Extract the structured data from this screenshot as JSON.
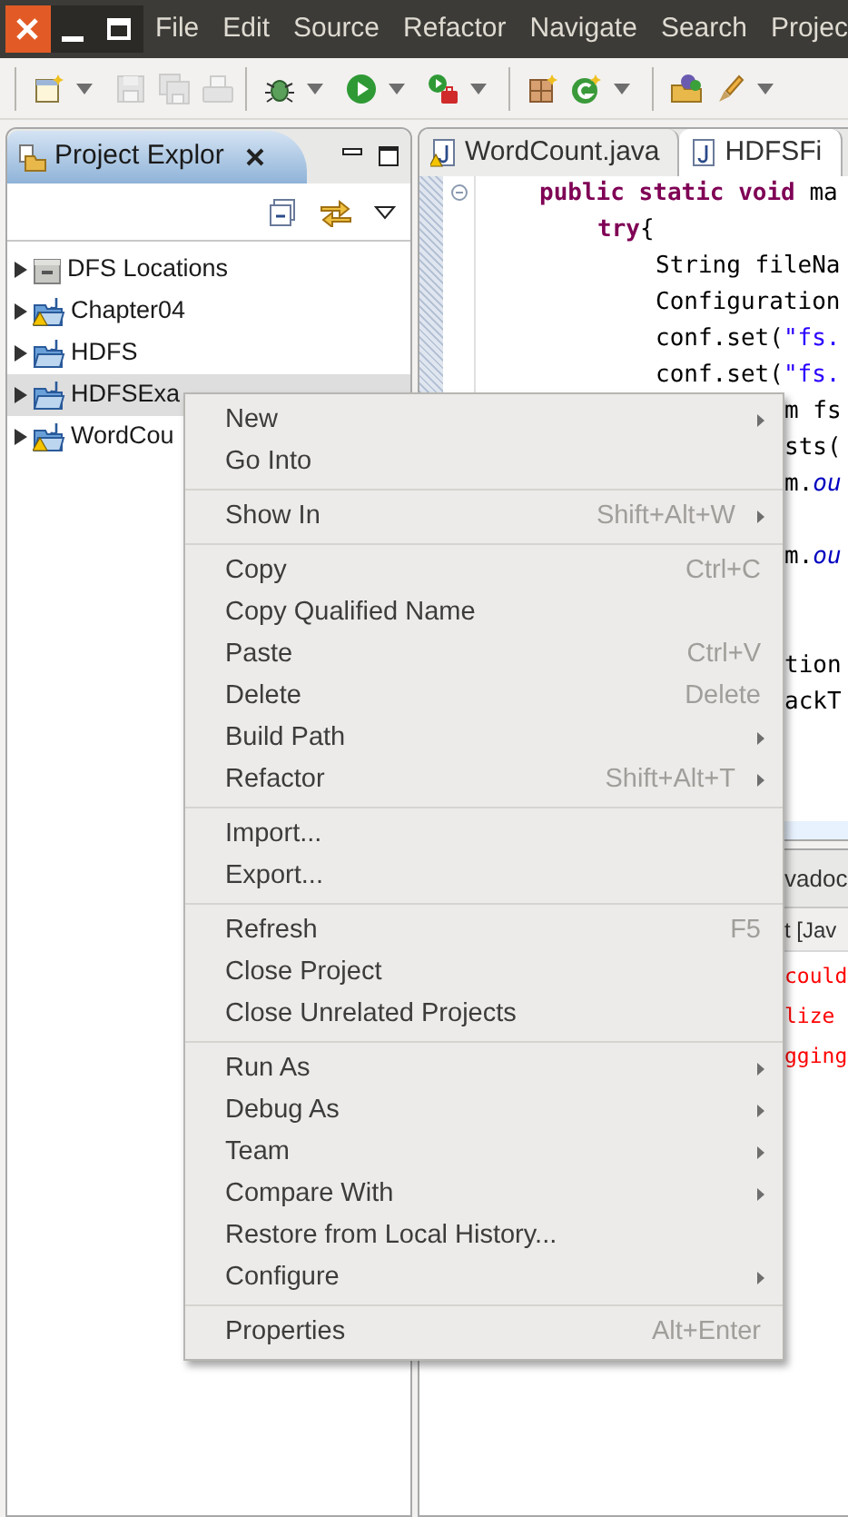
{
  "menubar": {
    "items": [
      "File",
      "Edit",
      "Source",
      "Refactor",
      "Navigate",
      "Search",
      "Projec"
    ]
  },
  "toolbar": {
    "groups": [
      [
        {
          "kind": "new",
          "disabled": false,
          "dropdown": true
        },
        {
          "kind": "save",
          "disabled": true,
          "dropdown": false
        },
        {
          "kind": "saveall",
          "disabled": true,
          "dropdown": false
        },
        {
          "kind": "print",
          "disabled": true,
          "dropdown": false
        }
      ],
      [
        {
          "kind": "debug",
          "disabled": false,
          "dropdown": true
        },
        {
          "kind": "run",
          "disabled": false,
          "dropdown": true
        },
        {
          "kind": "external",
          "disabled": false,
          "dropdown": true
        }
      ],
      [
        {
          "kind": "package",
          "disabled": false,
          "dropdown": false
        },
        {
          "kind": "newclass",
          "disabled": false,
          "dropdown": true
        }
      ],
      [
        {
          "kind": "openfolder",
          "disabled": false,
          "dropdown": false
        },
        {
          "kind": "brush",
          "disabled": false,
          "dropdown": true
        }
      ]
    ]
  },
  "explorer": {
    "title": "Project Explor",
    "items": [
      {
        "label": "DFS Locations",
        "kind": "dfs",
        "warning": false,
        "selected": false
      },
      {
        "label": "Chapter04",
        "kind": "project",
        "warning": true,
        "selected": false
      },
      {
        "label": "HDFS",
        "kind": "project",
        "warning": false,
        "selected": false
      },
      {
        "label": "HDFSExa",
        "kind": "project",
        "warning": false,
        "selected": true
      },
      {
        "label": "WordCou",
        "kind": "project",
        "warning": true,
        "selected": false
      }
    ]
  },
  "editor": {
    "tabs": [
      {
        "label": "WordCount.java",
        "warning": true,
        "selected": false
      },
      {
        "label": "HDFSFi",
        "warning": false,
        "selected": true
      }
    ],
    "lines": [
      {
        "kind": "code",
        "parts": [
          {
            "text": "public static void",
            "kind": "keyword"
          },
          {
            "text": " ma",
            "kind": "plain"
          }
        ],
        "children": [
          {
            "kind": "code",
            "parts": [
              {
                "text": "try",
                "kind": "keyword"
              },
              {
                "text": "{",
                "kind": "plain"
              }
            ],
            "children": [
              {
                "kind": "code",
                "parts": [
                  {
                    "text": "String fileNa",
                    "kind": "plain"
                  }
                ]
              },
              {
                "kind": "code",
                "parts": [
                  {
                    "text": "Configuration",
                    "kind": "plain"
                  }
                ]
              },
              {
                "kind": "code",
                "parts": [
                  {
                    "text": "conf.set(",
                    "kind": "plain"
                  },
                  {
                    "text": "\"fs.",
                    "kind": "string"
                  }
                ]
              },
              {
                "kind": "code",
                "parts": [
                  {
                    "text": "conf.set(",
                    "kind": "plain"
                  },
                  {
                    "text": "\"fs.",
                    "kind": "string"
                  }
                ]
              }
            ]
          }
        ]
      },
      {
        "kind": "behind",
        "parts": [
          {
            "text": "m fs",
            "kind": "plain"
          }
        ]
      },
      {
        "kind": "behind",
        "parts": [
          {
            "text": "sts(",
            "kind": "plain"
          }
        ]
      },
      {
        "kind": "behind",
        "parts": [
          {
            "text": "m.",
            "kind": "plain"
          },
          {
            "text": "ou",
            "kind": "field"
          }
        ]
      },
      {
        "kind": "blank"
      },
      {
        "kind": "behind",
        "parts": [
          {
            "text": "m.",
            "kind": "plain"
          },
          {
            "text": "ou",
            "kind": "field"
          }
        ]
      },
      {
        "kind": "blank"
      },
      {
        "kind": "blank"
      },
      {
        "kind": "behind",
        "parts": [
          {
            "text": "tion",
            "kind": "plain"
          }
        ]
      },
      {
        "kind": "behind",
        "parts": [
          {
            "text": "ackT",
            "kind": "plain"
          }
        ]
      }
    ]
  },
  "bottom_panel": {
    "tab": "vadoc",
    "console_title": "t [Jav",
    "output": [
      "could",
      "lize",
      "gging"
    ]
  },
  "context_menu": {
    "groups": [
      [
        {
          "label": "New",
          "submenu": true
        },
        {
          "label": "Go Into",
          "submenu": false
        }
      ],
      [
        {
          "label": "Show In",
          "shortcut": "Shift+Alt+W",
          "submenu": true
        }
      ],
      [
        {
          "label": "Copy",
          "shortcut": "Ctrl+C",
          "submenu": false
        },
        {
          "label": "Copy Qualified Name",
          "submenu": false
        },
        {
          "label": "Paste",
          "shortcut": "Ctrl+V",
          "submenu": false
        },
        {
          "label": "Delete",
          "shortcut": "Delete",
          "submenu": false
        },
        {
          "label": "Build Path",
          "submenu": true
        },
        {
          "label": "Refactor",
          "shortcut": "Shift+Alt+T",
          "submenu": true
        }
      ],
      [
        {
          "label": "Import...",
          "submenu": false
        },
        {
          "label": "Export...",
          "submenu": false
        }
      ],
      [
        {
          "label": "Refresh",
          "shortcut": "F5",
          "submenu": false
        },
        {
          "label": "Close Project",
          "submenu": false
        },
        {
          "label": "Close Unrelated Projects",
          "submenu": false
        }
      ],
      [
        {
          "label": "Run As",
          "submenu": true
        },
        {
          "label": "Debug As",
          "submenu": true
        },
        {
          "label": "Team",
          "submenu": true
        },
        {
          "label": "Compare With",
          "submenu": true
        },
        {
          "label": "Restore from Local History...",
          "submenu": false
        },
        {
          "label": "Configure",
          "submenu": true
        }
      ],
      [
        {
          "label": "Properties",
          "shortcut": "Alt+Enter",
          "submenu": false
        }
      ]
    ]
  }
}
